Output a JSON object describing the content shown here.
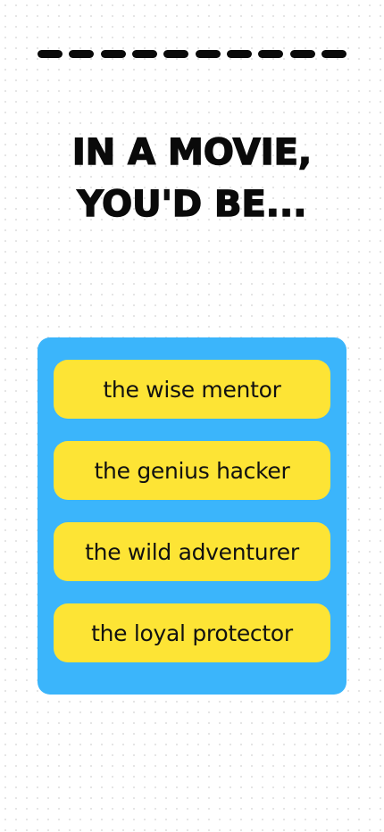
{
  "progress": {
    "total_steps": 10,
    "segment_color": "#0a0a0a"
  },
  "question": {
    "line1": "IN A MOVIE,",
    "line2": "YOU'D BE..."
  },
  "options": [
    {
      "label": "the wise mentor"
    },
    {
      "label": "the genius hacker"
    },
    {
      "label": "the wild adventurer"
    },
    {
      "label": "the loyal protector"
    }
  ],
  "colors": {
    "panel": "#3bb5fb",
    "option": "#fde435",
    "text": "#111111"
  }
}
